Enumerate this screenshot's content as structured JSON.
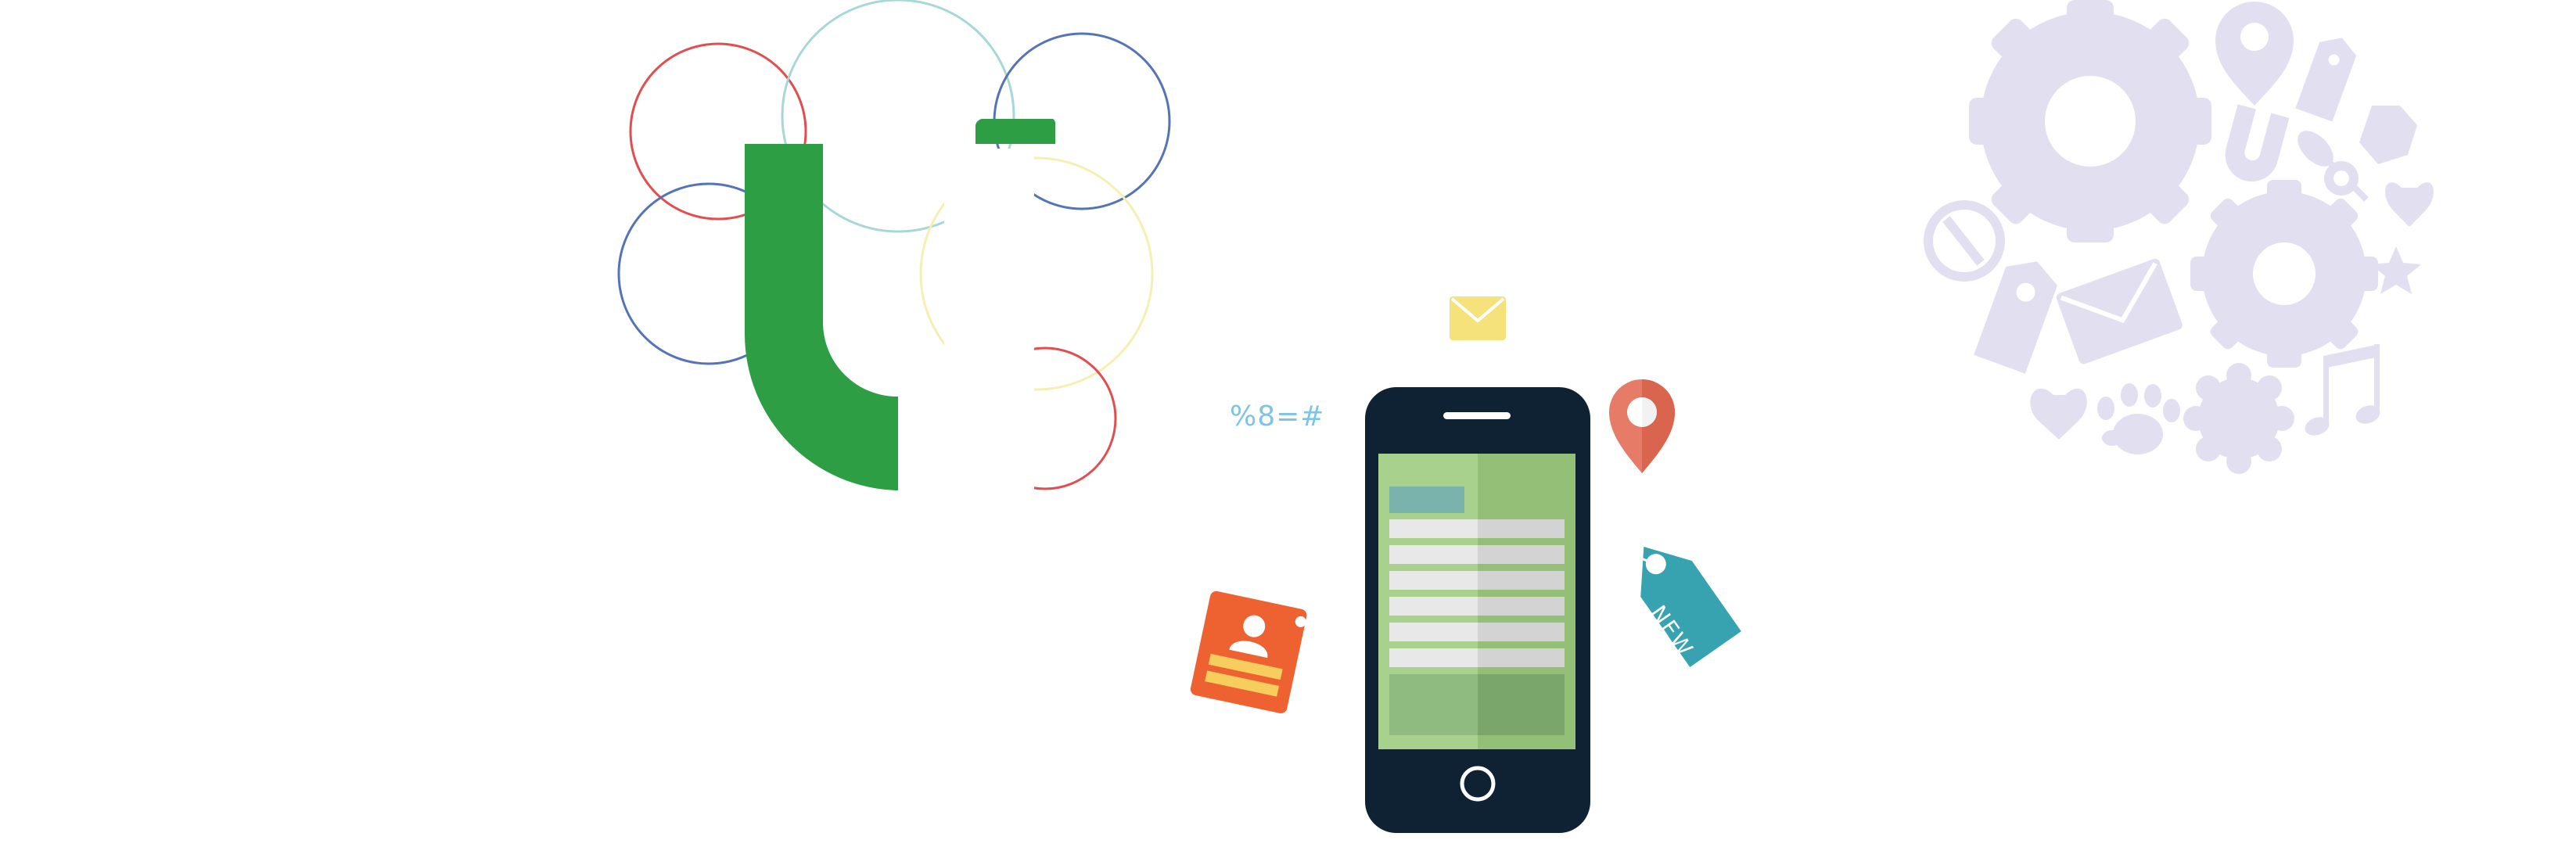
{
  "decorative_text": {
    "symbols": "%8=#",
    "tag_label": "NEW"
  },
  "colors": {
    "green": "#2e9e44",
    "circle_red": "#e24d4f",
    "circle_blue": "#5574b8",
    "circle_teal": "#a6d8d6",
    "circle_yellow": "#f4f0b2",
    "phone_body": "#0f2233",
    "screen_green": "#a9d18e",
    "envelope_yellow": "#f6e27a",
    "pin_coral": "#e67b67",
    "tag_teal": "#37a3b0",
    "card_orange": "#ee6231",
    "card_stripe": "#f7cd5e",
    "icon_lavender": "#e2dff0"
  },
  "icons": [
    "logo-mark",
    "phone",
    "envelope-icon",
    "map-pin-icon",
    "new-tag-icon",
    "contact-card-icon",
    "gear-icon",
    "gear-small-icon",
    "map-pin-outline-icon",
    "price-tag-icon",
    "horseshoe-magnet-icon",
    "hexagon-icon",
    "pushpin-icon",
    "heart-icon",
    "no-entry-icon",
    "label-tag-icon",
    "mail-icon",
    "star-icon",
    "paw-icon",
    "flower-badge-icon",
    "music-note-icon"
  ]
}
